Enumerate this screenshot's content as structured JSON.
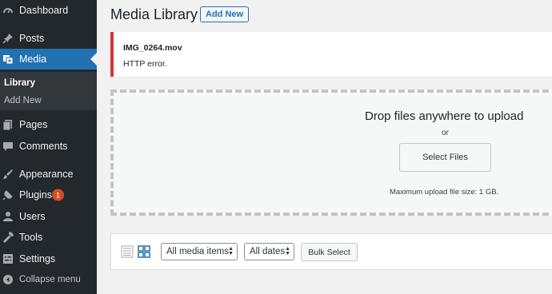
{
  "sidebar": {
    "items": [
      {
        "label": "Dashboard",
        "icon": "dashboard-icon"
      },
      {
        "label": "Posts",
        "icon": "pushpin-icon"
      },
      {
        "label": "Media",
        "icon": "media-icon"
      },
      {
        "label": "Pages",
        "icon": "pages-icon"
      },
      {
        "label": "Comments",
        "icon": "comment-icon"
      },
      {
        "label": "Appearance",
        "icon": "paintbrush-icon"
      },
      {
        "label": "Plugins",
        "icon": "plug-icon",
        "badge": "1"
      },
      {
        "label": "Users",
        "icon": "user-icon"
      },
      {
        "label": "Tools",
        "icon": "wrench-icon"
      },
      {
        "label": "Settings",
        "icon": "settings-icon"
      }
    ],
    "submenu": [
      {
        "label": "Library"
      },
      {
        "label": "Add New"
      }
    ],
    "collapse_label": "Collapse menu",
    "colors": {
      "background": "#23282d",
      "current": "#2271b1",
      "submenu": "#32373c",
      "badge": "#d54e21"
    }
  },
  "header": {
    "title": "Media Library",
    "add_new_label": "Add New"
  },
  "notice": {
    "filename": "IMG_0264.mov",
    "message": "HTTP error.",
    "color": "#d63638"
  },
  "uploader": {
    "title": "Drop files anywhere to upload",
    "or_text": "or",
    "select_button": "Select Files",
    "max_size": "Maximum upload file size: 1 GB."
  },
  "toolbar": {
    "list_view_icon": "list-view-icon",
    "grid_view_icon": "grid-view-icon",
    "type_filter": "All media items",
    "date_filter": "All dates",
    "bulk_select_label": "Bulk Select"
  }
}
